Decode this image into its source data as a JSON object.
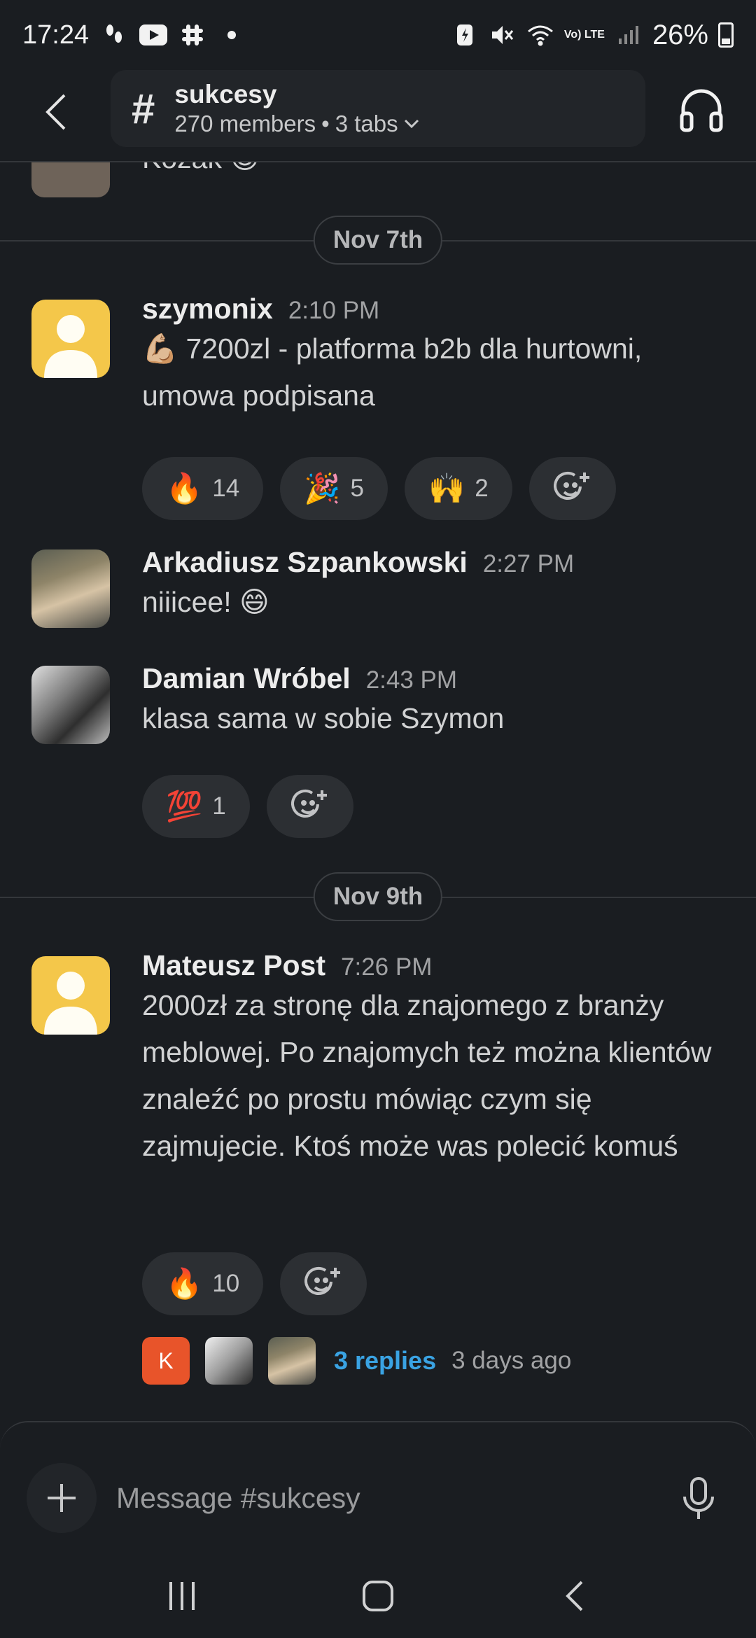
{
  "status_bar": {
    "time": "17:24",
    "battery": "26%",
    "network": "Vo) LTE"
  },
  "header": {
    "channel_name": "sukcesy",
    "members": "270 members",
    "tabs": "3 tabs"
  },
  "peek_message": {
    "text": "Kozak 😊"
  },
  "dates": [
    "Nov 7th",
    "Nov 9th"
  ],
  "messages": [
    {
      "author": "szymonix",
      "time": "2:10 PM",
      "body": "💪🏼 7200zl - platforma b2b dla hurtowni, umowa podpisana",
      "reactions": [
        {
          "emoji": "🔥",
          "count": "14"
        },
        {
          "emoji": "🎉",
          "count": "5"
        },
        {
          "emoji": "🙌",
          "count": "2"
        }
      ]
    },
    {
      "author": "Arkadiusz Szpankowski",
      "time": "2:27 PM",
      "body": "niiicee! 😄"
    },
    {
      "author": "Damian Wróbel",
      "time": "2:43 PM",
      "body": "klasa sama w sobie Szymon",
      "reactions": [
        {
          "emoji": "💯",
          "count": "1"
        }
      ]
    },
    {
      "author": "Mateusz Post",
      "time": "7:26 PM",
      "body": "2000zł za stronę dla znajomego z branży meblowej. Po znajomych też można klientów znaleźć po prostu mówiąc czym się zajmujecie. Ktoś może was polecić komuś",
      "reactions": [
        {
          "emoji": "🔥",
          "count": "10"
        }
      ],
      "thread": {
        "avatar_letter": "K",
        "replies": "3 replies",
        "last_reply": "3 days ago"
      }
    }
  ],
  "composer": {
    "placeholder": "Message #sukcesy"
  },
  "colors": {
    "background": "#1a1d21",
    "link": "#3aa3e3",
    "avatar_yellow": "#f4c74a",
    "thread_k_avatar": "#e8542a"
  }
}
